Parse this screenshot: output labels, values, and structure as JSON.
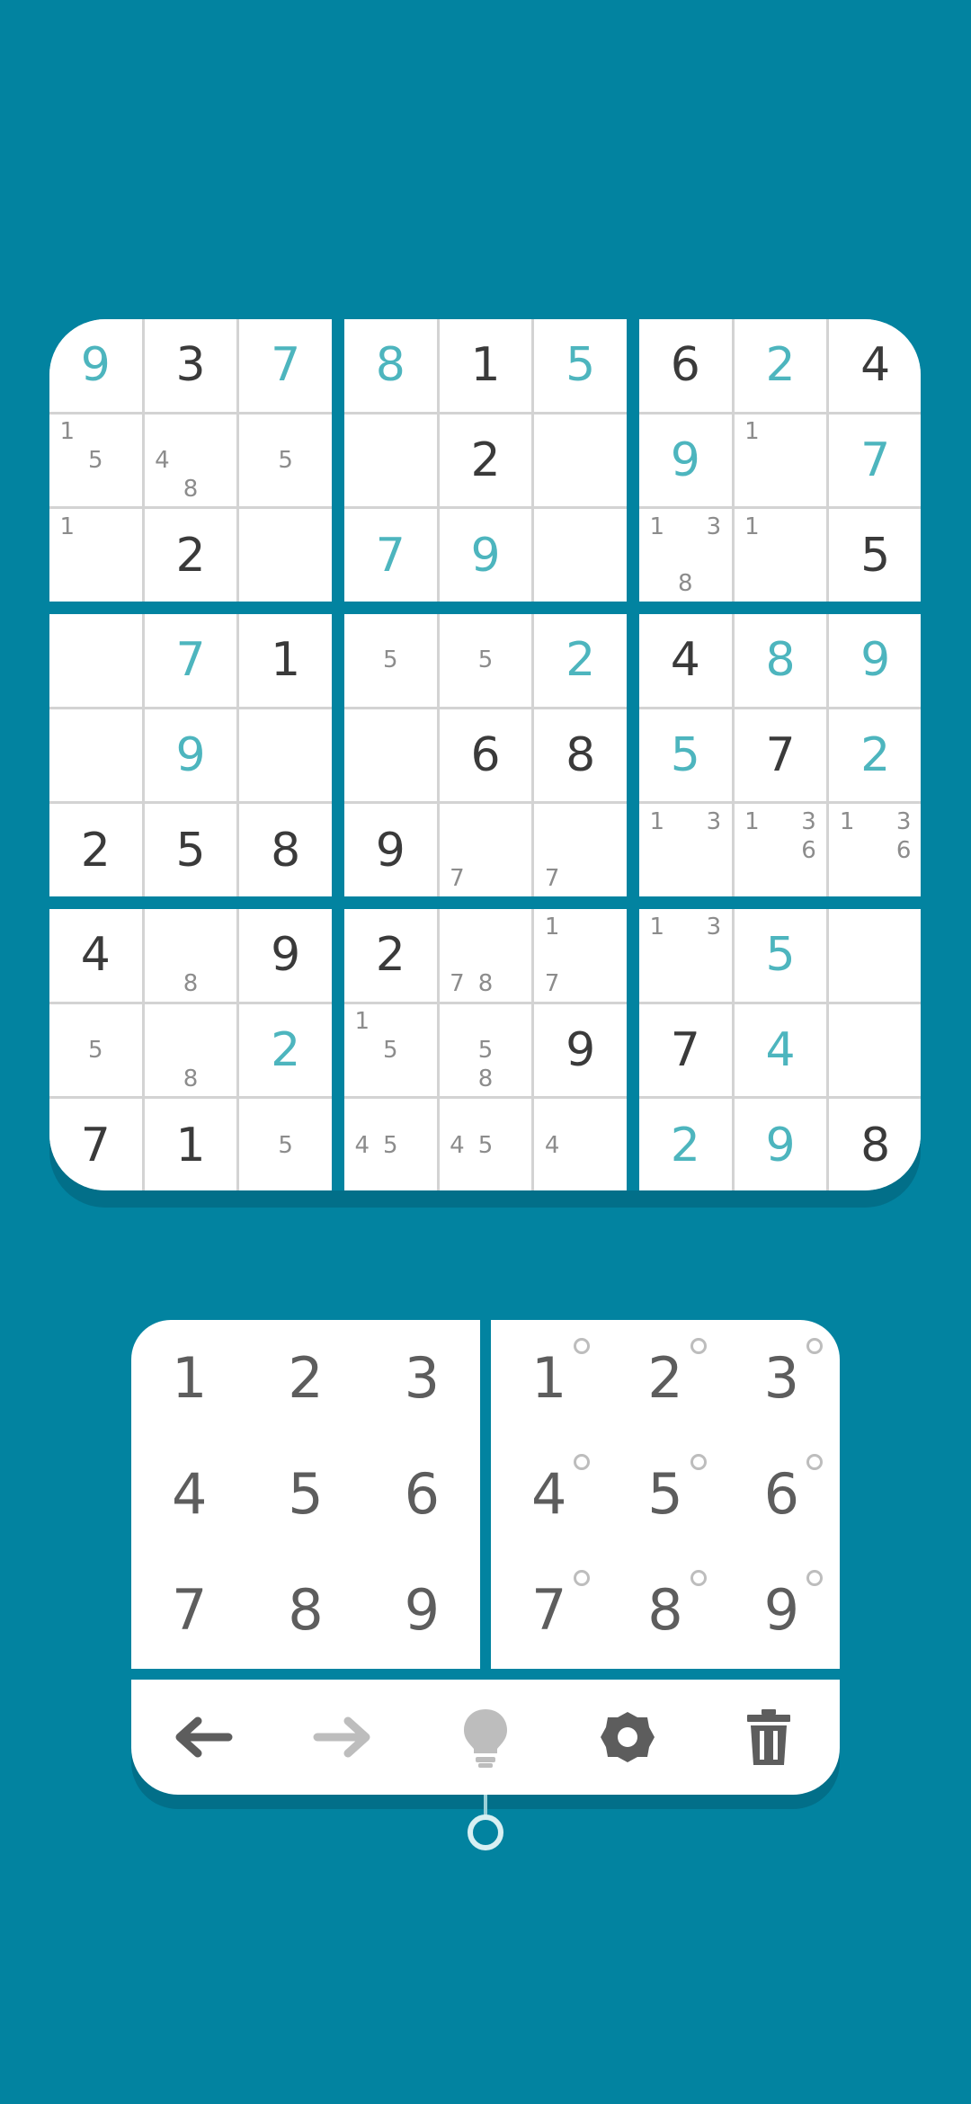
{
  "colors": {
    "background": "#0283a0",
    "given_digit": "#3a3a3a",
    "entered_digit": "#4db5be",
    "note_digit": "#8c8c8c",
    "pad_digit": "#5d5d5d"
  },
  "board": {
    "rows": [
      [
        {
          "v": "9",
          "t": "entered"
        },
        {
          "v": "3",
          "t": "given"
        },
        {
          "v": "7",
          "t": "entered"
        },
        {
          "v": "8",
          "t": "entered"
        },
        {
          "v": "1",
          "t": "given"
        },
        {
          "v": "5",
          "t": "entered"
        },
        {
          "v": "6",
          "t": "given"
        },
        {
          "v": "2",
          "t": "entered"
        },
        {
          "v": "4",
          "t": "given"
        }
      ],
      [
        {
          "notes": [
            "1",
            "5"
          ]
        },
        {
          "notes": [
            "4",
            "8"
          ]
        },
        {
          "notes": [
            "5"
          ]
        },
        {},
        {
          "v": "2",
          "t": "given"
        },
        {},
        {
          "v": "9",
          "t": "entered"
        },
        {
          "notes": [
            "1"
          ]
        },
        {
          "v": "7",
          "t": "entered"
        }
      ],
      [
        {
          "notes": [
            "1"
          ]
        },
        {
          "v": "2",
          "t": "given"
        },
        {},
        {
          "v": "7",
          "t": "entered"
        },
        {
          "v": "9",
          "t": "entered"
        },
        {},
        {
          "notes": [
            "1",
            "3",
            "8"
          ]
        },
        {
          "notes": [
            "1"
          ]
        },
        {
          "v": "5",
          "t": "given"
        }
      ],
      [
        {},
        {
          "v": "7",
          "t": "entered"
        },
        {
          "v": "1",
          "t": "given"
        },
        {
          "notes": [
            "5"
          ]
        },
        {
          "notes": [
            "5"
          ]
        },
        {
          "v": "2",
          "t": "entered"
        },
        {
          "v": "4",
          "t": "given"
        },
        {
          "v": "8",
          "t": "entered"
        },
        {
          "v": "9",
          "t": "entered"
        }
      ],
      [
        {},
        {
          "v": "9",
          "t": "entered"
        },
        {},
        {},
        {
          "v": "6",
          "t": "given"
        },
        {
          "v": "8",
          "t": "given"
        },
        {
          "v": "5",
          "t": "entered"
        },
        {
          "v": "7",
          "t": "given"
        },
        {
          "v": "2",
          "t": "entered"
        }
      ],
      [
        {
          "v": "2",
          "t": "given"
        },
        {
          "v": "5",
          "t": "given"
        },
        {
          "v": "8",
          "t": "given"
        },
        {
          "v": "9",
          "t": "given"
        },
        {
          "notes": [
            "7"
          ]
        },
        {
          "notes": [
            "7"
          ]
        },
        {
          "notes": [
            "1",
            "3"
          ]
        },
        {
          "notes": [
            "1",
            "3",
            "6"
          ]
        },
        {
          "notes": [
            "1",
            "3",
            "6"
          ]
        }
      ],
      [
        {
          "v": "4",
          "t": "given"
        },
        {
          "notes": [
            "8"
          ]
        },
        {
          "v": "9",
          "t": "given"
        },
        {
          "v": "2",
          "t": "given"
        },
        {
          "notes": [
            "7",
            "8"
          ]
        },
        {
          "notes": [
            "1",
            "7"
          ]
        },
        {
          "notes": [
            "1",
            "3"
          ]
        },
        {
          "v": "5",
          "t": "entered"
        },
        {}
      ],
      [
        {
          "notes": [
            "5"
          ]
        },
        {
          "notes": [
            "8"
          ]
        },
        {
          "v": "2",
          "t": "entered"
        },
        {
          "notes": [
            "1",
            "5"
          ]
        },
        {
          "notes": [
            "5",
            "8"
          ]
        },
        {
          "v": "9",
          "t": "given"
        },
        {
          "v": "7",
          "t": "given"
        },
        {
          "v": "4",
          "t": "entered"
        },
        {}
      ],
      [
        {
          "v": "7",
          "t": "given"
        },
        {
          "v": "1",
          "t": "given"
        },
        {
          "notes": [
            "5"
          ]
        },
        {
          "notes": [
            "4",
            "5"
          ]
        },
        {
          "notes": [
            "4",
            "5"
          ]
        },
        {
          "notes": [
            "4"
          ]
        },
        {
          "v": "2",
          "t": "entered"
        },
        {
          "v": "9",
          "t": "entered"
        },
        {
          "v": "8",
          "t": "given"
        }
      ]
    ]
  },
  "number_pad": {
    "digits": [
      "1",
      "2",
      "3",
      "4",
      "5",
      "6",
      "7",
      "8",
      "9"
    ]
  },
  "notes_pad": {
    "digits": [
      "1",
      "2",
      "3",
      "4",
      "5",
      "6",
      "7",
      "8",
      "9"
    ]
  },
  "toolbar": {
    "items": [
      {
        "name": "undo",
        "icon": "arrow-left-icon",
        "enabled": true
      },
      {
        "name": "redo",
        "icon": "arrow-right-icon",
        "enabled": false
      },
      {
        "name": "hint",
        "icon": "lightbulb-icon",
        "enabled": true
      },
      {
        "name": "settings",
        "icon": "gear-icon",
        "enabled": true
      },
      {
        "name": "erase",
        "icon": "trash-icon",
        "enabled": true
      }
    ]
  }
}
